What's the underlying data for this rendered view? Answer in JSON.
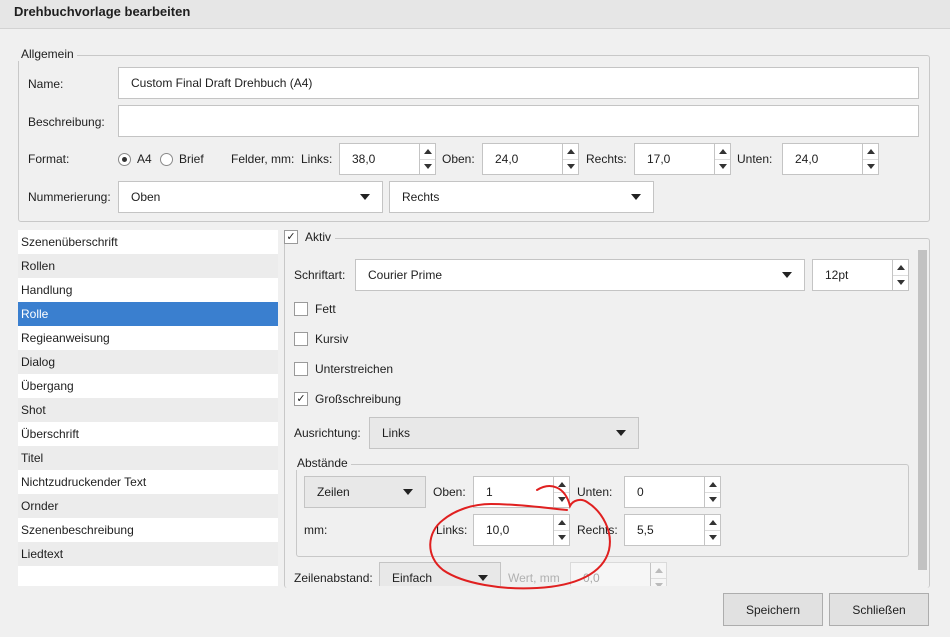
{
  "window": {
    "title": "Drehbuchvorlage bearbeiten"
  },
  "general": {
    "legend": "Allgemein",
    "name_label": "Name:",
    "name_value": "Custom Final Draft Drehbuch (A4)",
    "description_label": "Beschreibung:",
    "description_value": "",
    "format_label": "Format:",
    "format_a4": "A4",
    "format_letter": "Brief",
    "format_selected": "A4",
    "margins_label": "Felder, mm:",
    "left_label": "Links:",
    "left_value": "38,0",
    "top_label": "Oben:",
    "top_value": "24,0",
    "right_label": "Rechts:",
    "right_value": "17,0",
    "bottom_label": "Unten:",
    "bottom_value": "24,0",
    "numbering_label": "Nummerierung:",
    "numbering_vertical": "Oben",
    "numbering_horizontal": "Rechts"
  },
  "block_types": [
    "Szenenüberschrift",
    "Rollen",
    "Handlung",
    "Rolle",
    "Regieanweisung",
    "Dialog",
    "Übergang",
    "Shot",
    "Überschrift",
    "Titel",
    "Nichtzudruckender Text",
    "Ornder",
    "Szenenbeschreibung",
    "Liedtext"
  ],
  "selected_block": "Rolle",
  "block": {
    "active_label": "Aktiv",
    "active_checked": true,
    "font_label": "Schriftart:",
    "font_value": "Courier Prime",
    "font_size": "12pt",
    "bold_label": "Fett",
    "bold_checked": false,
    "italic_label": "Kursiv",
    "italic_checked": false,
    "underline_label": "Unterstreichen",
    "underline_checked": false,
    "uppercase_label": "Großschreibung",
    "uppercase_checked": true,
    "alignment_label": "Ausrichtung:",
    "alignment_value": "Links",
    "spacing": {
      "legend": "Abstände",
      "unit_value": "Zeilen",
      "top_label": "Oben:",
      "top_value": "1",
      "bottom_label": "Unten:",
      "bottom_value": "0",
      "mm_label": "mm:",
      "left_label": "Links:",
      "left_value": "10,0",
      "right_label": "Rechts:",
      "right_value": "5,5"
    },
    "line_spacing_label": "Zeilenabstand:",
    "line_spacing_value": "Einfach",
    "line_value_label": "Wert, mm",
    "line_value": "0,0"
  },
  "buttons": {
    "save": "Speichern",
    "close": "Schließen"
  },
  "colors": {
    "selection": "#3a7fcf",
    "annotation": "#e02020"
  },
  "icons": [
    "checkmark-icon",
    "chevron-down-icon",
    "spinner-up-icon",
    "spinner-down-icon"
  ]
}
